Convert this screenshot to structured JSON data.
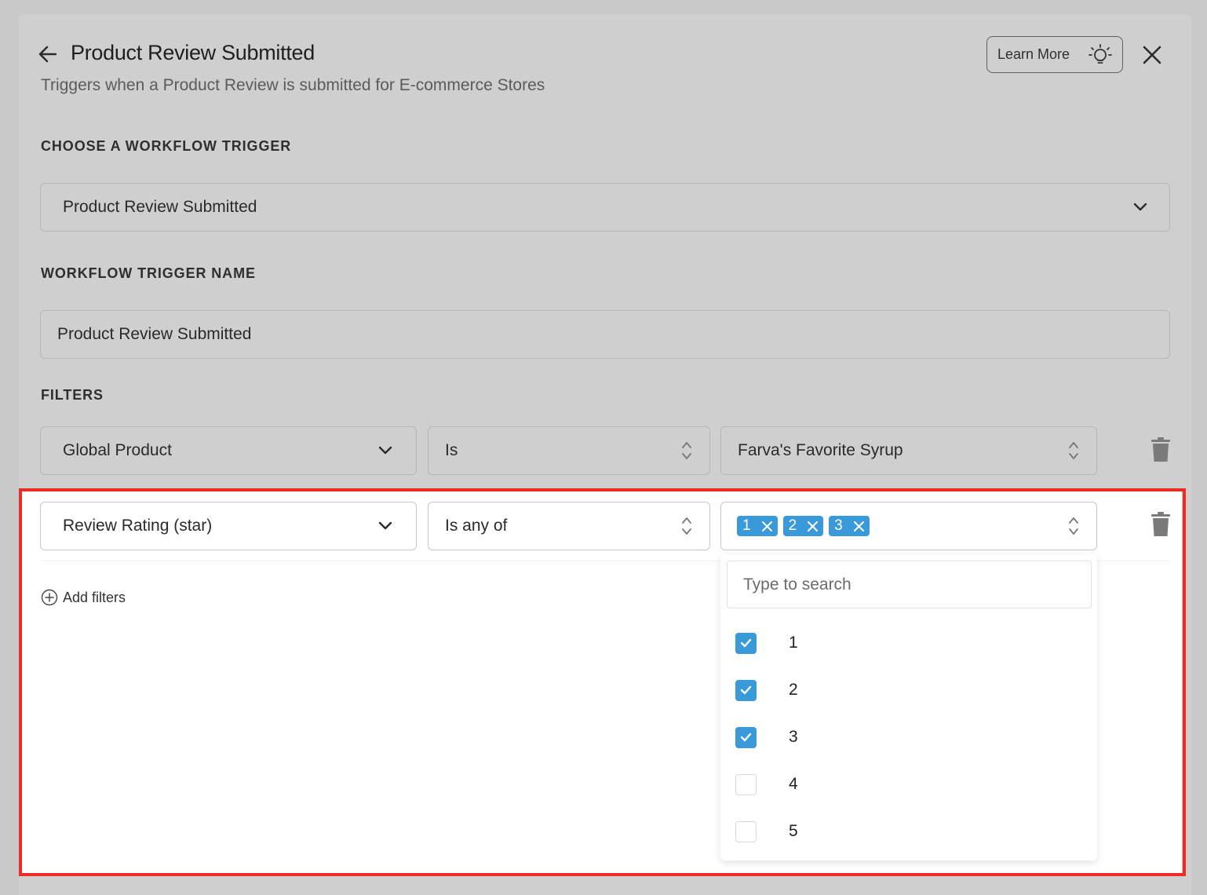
{
  "header": {
    "title": "Product Review Submitted",
    "subtitle": "Triggers when a Product Review is submitted for E-commerce Stores",
    "learn_more_label": "Learn More"
  },
  "trigger": {
    "section_label": "CHOOSE A WORKFLOW TRIGGER",
    "selected": "Product Review Submitted"
  },
  "trigger_name": {
    "section_label": "WORKFLOW TRIGGER NAME",
    "value": "Product Review Submitted"
  },
  "filters": {
    "section_label": "FILTERS",
    "rows": [
      {
        "field": "Global Product",
        "operator": "Is",
        "value": "Farva's Favorite Syrup"
      },
      {
        "field": "Review Rating (star)",
        "operator": "Is any of",
        "chips": [
          "1",
          "2",
          "3"
        ]
      }
    ],
    "add_label": "Add filters"
  },
  "dropdown": {
    "search_placeholder": "Type to search",
    "options": [
      {
        "label": "1",
        "checked": true
      },
      {
        "label": "2",
        "checked": true
      },
      {
        "label": "3",
        "checked": true
      },
      {
        "label": "4",
        "checked": false
      },
      {
        "label": "5",
        "checked": false
      }
    ]
  },
  "colors": {
    "accent": "#3a9ad9",
    "highlight": "#ee2b24",
    "overlay": "#cfcfcf"
  },
  "icons": [
    "arrow-left-icon",
    "lightbulb-icon",
    "close-icon",
    "chevron-down-icon",
    "chevron-up-down-icon",
    "trash-icon",
    "plus-circle-icon",
    "check-icon",
    "x-icon"
  ]
}
